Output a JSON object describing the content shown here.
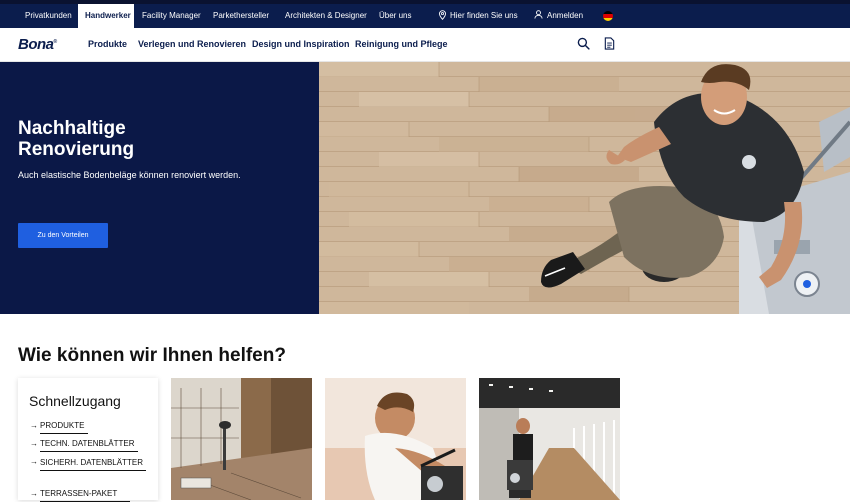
{
  "topbar": {
    "segments": [
      "Privatkunden",
      "Handwerker",
      "Facility Manager",
      "Parkethersteller",
      "Architekten & Designer",
      "Über uns"
    ],
    "active_index": 1,
    "store_locator": "Hier finden Sie uns",
    "login": "Anmelden"
  },
  "nav": {
    "logo": "Bona",
    "items": [
      "Produkte",
      "Verlegen und Renovieren",
      "Design und Inspiration",
      "Reinigung und Pflege"
    ]
  },
  "hero": {
    "title_line1": "Nachhaltige",
    "title_line2": "Renovierung",
    "subtitle": "Auch elastische Bodenbeläge können renoviert werden.",
    "cta": "Zu den Vorteilen"
  },
  "help": {
    "title": "Wie können wir Ihnen helfen?",
    "quick_title": "Schnellzugang",
    "quick_items": [
      "PRODUKTE",
      "TECHN. DATENBLÄTTER",
      "SICHERH. DATENBLÄTTER",
      "TERRASSEN-PAKET"
    ]
  },
  "colors": {
    "navy": "#0b1d4d",
    "hero_navy": "#0b1847",
    "cta_blue": "#1f5fe0"
  }
}
